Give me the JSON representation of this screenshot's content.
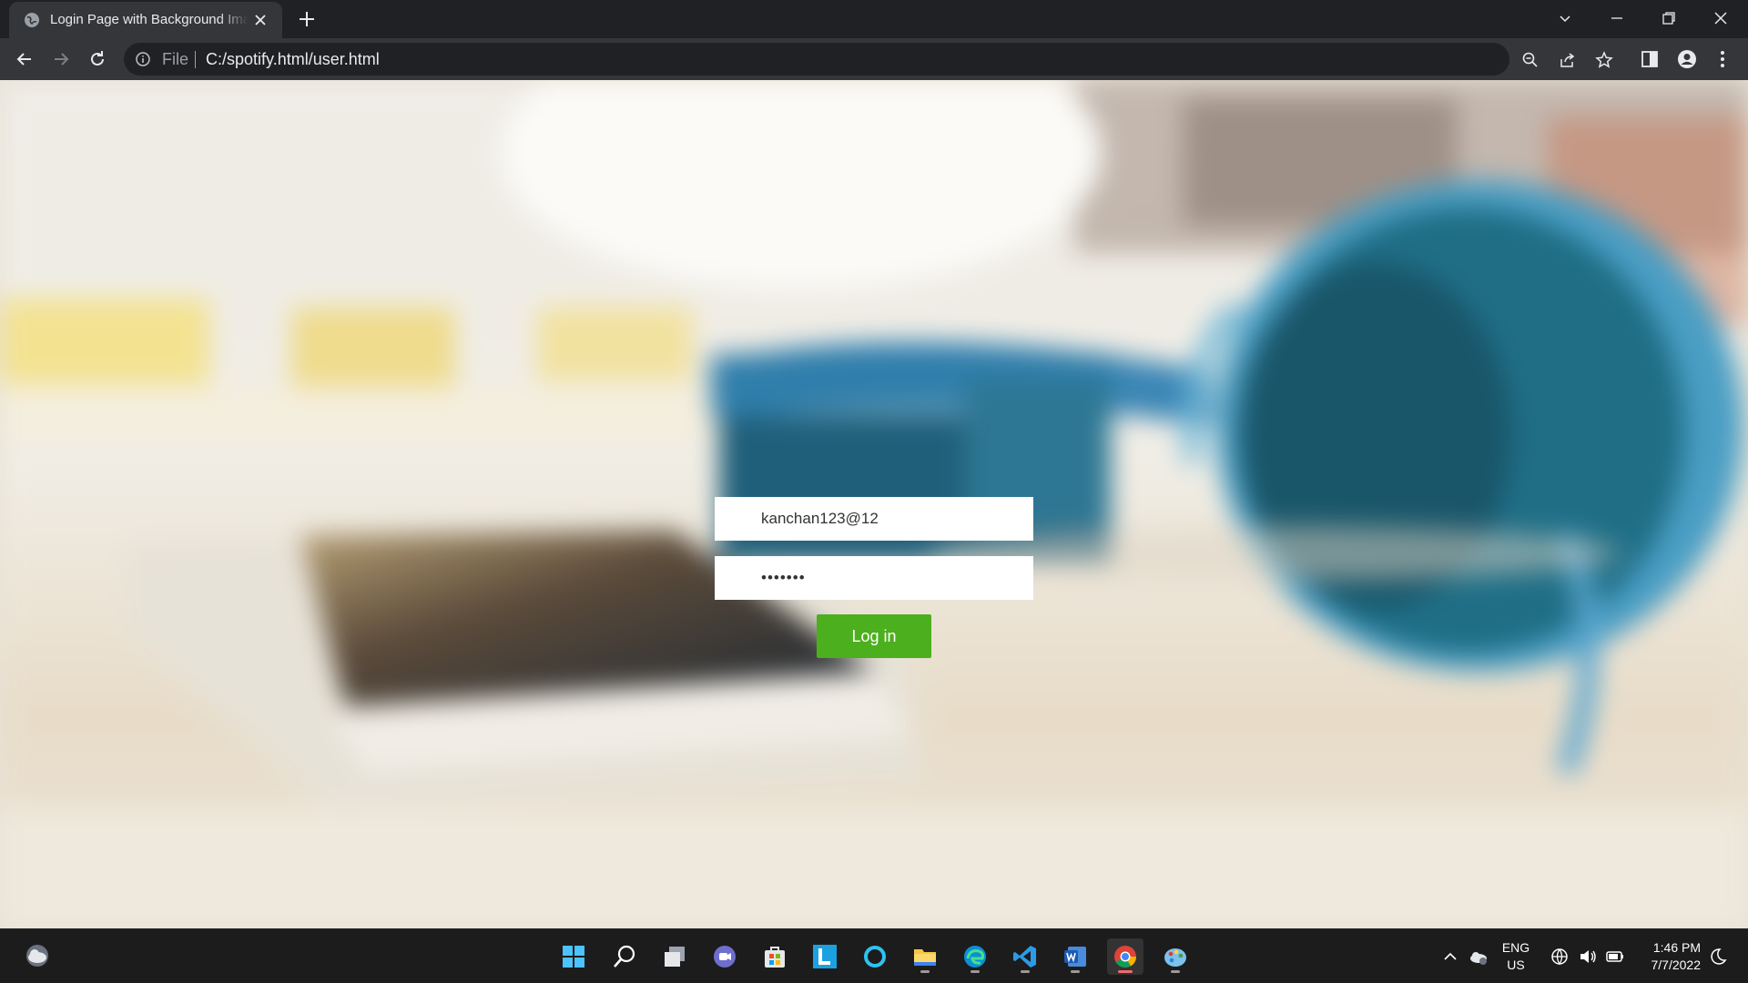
{
  "browser": {
    "tab_title": "Login Page with Background Image",
    "scheme_label": "File",
    "url": "C:/spotify.html/user.html"
  },
  "login": {
    "username_value": "kanchan123@12",
    "password_value": "•••••••",
    "login_label": "Log in"
  },
  "taskbar": {
    "apps": [
      "start-icon",
      "search-icon",
      "task-view-icon",
      "teams-chat-icon",
      "store-icon",
      "l-app-icon",
      "cortana-icon",
      "file-explorer-icon",
      "edge-icon",
      "vscode-icon",
      "word-icon",
      "chrome-icon",
      "paint-icon"
    ],
    "lang_top": "ENG",
    "lang_bottom": "US",
    "time": "1:46 PM",
    "date": "7/7/2022"
  },
  "colors": {
    "login_button": "#4caf1d",
    "chrome_dark": "#202124",
    "chrome_toolbar": "#35363a"
  }
}
